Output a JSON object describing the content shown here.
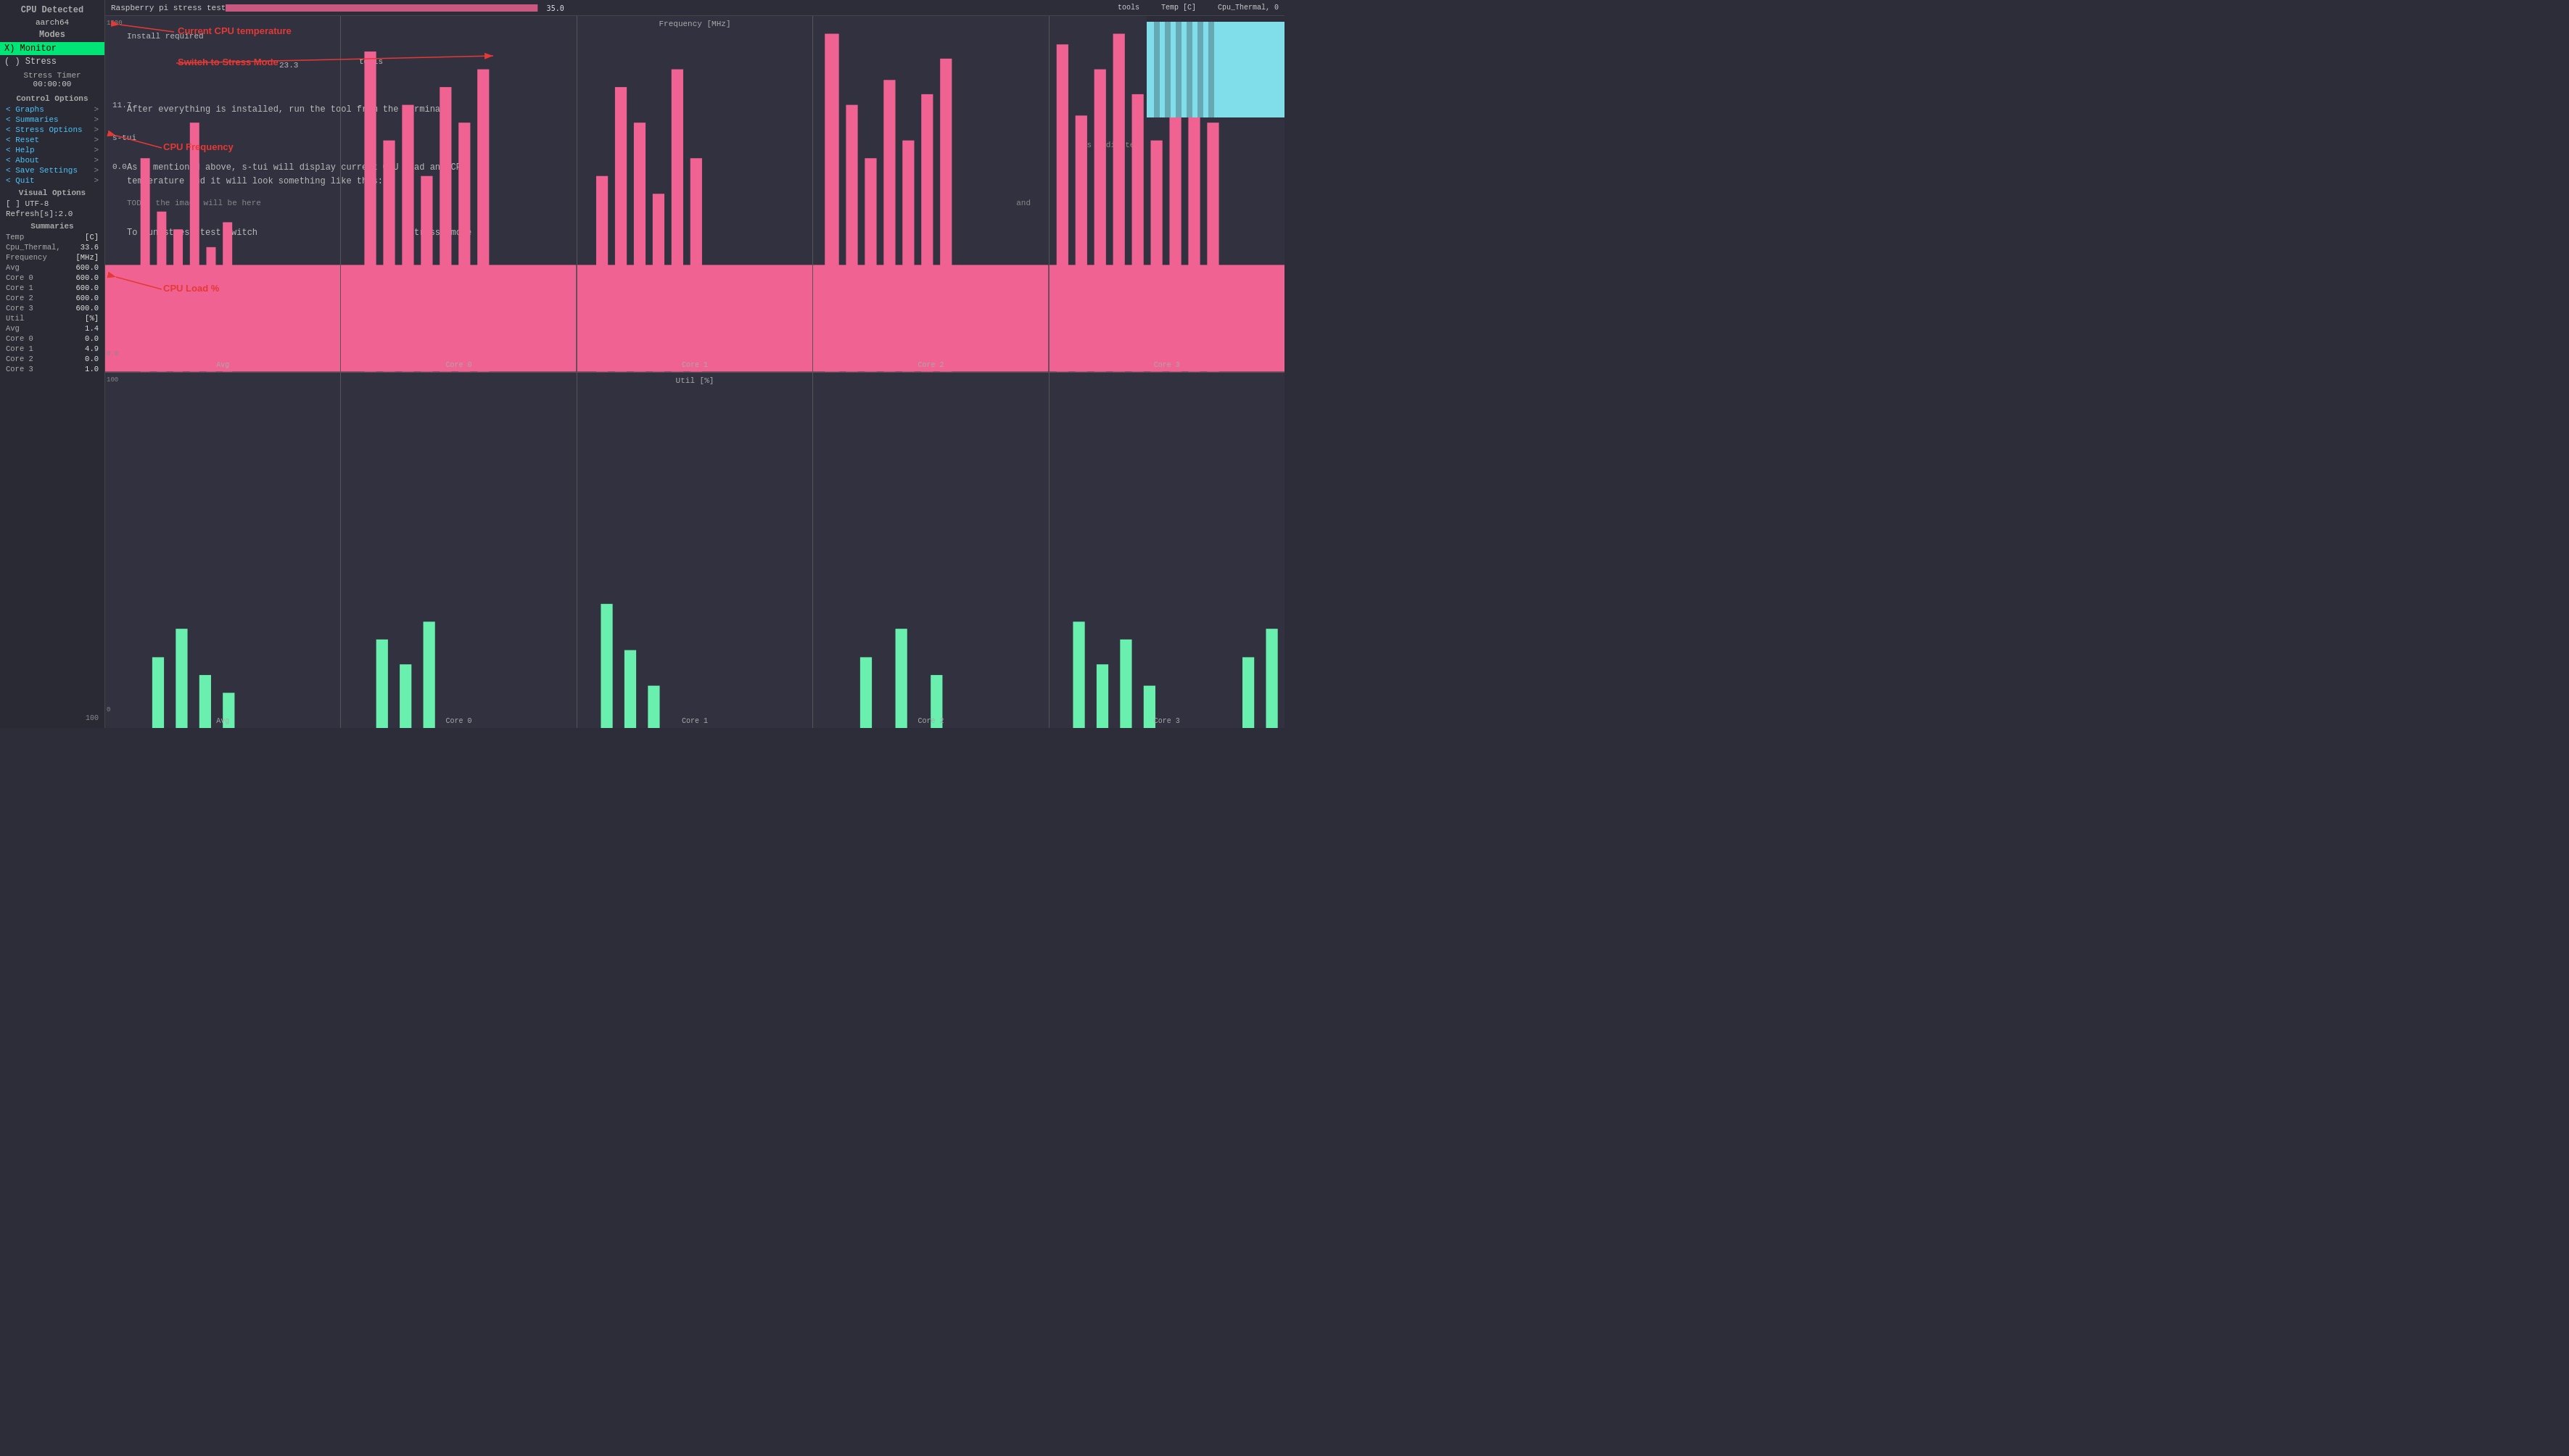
{
  "sidebar": {
    "cpu_detected_label": "CPU Detected",
    "cpu_arch": "aarch64",
    "modes_label": "Modes",
    "mode_monitor": "X) Monitor",
    "mode_stress": "( ) Stress",
    "stress_timer_label": "Stress Timer",
    "stress_timer_value": "00:00:00",
    "control_options_label": "Control Options",
    "menu_items": [
      {
        "label": "< Graphs",
        "chevron": ">"
      },
      {
        "label": "< Summaries",
        "chevron": ">"
      },
      {
        "label": "< Stress Options",
        "chevron": ">"
      },
      {
        "label": "< Reset",
        "chevron": ">"
      },
      {
        "label": "< Help",
        "chevron": ">"
      },
      {
        "label": "< About",
        "chevron": ">"
      },
      {
        "label": "< Save Settings",
        "chevron": ">"
      },
      {
        "label": "< Quit",
        "chevron": ">"
      }
    ],
    "visual_options_label": "Visual Options",
    "charset": "[ ] UTF-8",
    "refresh": "Refresh[s]:2.0",
    "summaries_label": "Summaries",
    "temp_label": "Temp",
    "temp_unit": "[C]",
    "temp_sensor": "Cpu_Thermal,",
    "temp_value": "33.6",
    "freq_label": "Frequency",
    "freq_unit": "[MHz]",
    "freq_avg_label": "Avg",
    "freq_avg_value": "600.0",
    "freq_core0_label": "Core 0",
    "freq_core0_value": "600.0",
    "freq_core1_label": "Core 1",
    "freq_core1_value": "600.0",
    "freq_core2_label": "Core 2",
    "freq_core2_value": "600.0",
    "freq_core3_label": "Core 3",
    "freq_core3_value": "600.0",
    "util_label": "Util",
    "util_unit": "[%]",
    "util_avg_label": "Avg",
    "util_avg_value": "1.4",
    "util_core0_label": "Core 0",
    "util_core0_value": "0.0",
    "util_core1_label": "Core 1",
    "util_core1_value": "4.9",
    "util_core2_label": "Core 2",
    "util_core2_value": "0.0",
    "util_core3_label": "Core 3",
    "util_core3_value": "1.0"
  },
  "topbar": {
    "title": "Raspberry pi stress test",
    "temp_current": "35.0",
    "tools_label": "tools",
    "temp_c_label": "Temp [C]",
    "cpu_thermal_label": "Cpu_Thermal, 0"
  },
  "freq_chart": {
    "y_max": "1500",
    "y_min": "0",
    "label_freq": "Frequency [MHz]",
    "sections": [
      "Avg",
      "Core 0",
      "Core 1",
      "Core 2",
      "Core 3"
    ]
  },
  "util_chart": {
    "y_max": "100",
    "y_min": "0",
    "label_util": "Util [%]",
    "sections": [
      "Avg",
      "Core 0",
      "Core 1",
      "Core 2",
      "Core 3"
    ]
  },
  "annotations": {
    "cpu_temp_label": "Current CPU temperature",
    "stress_mode_label": "Switch to Stress Mode",
    "cpu_freq_label": "CPU Frequency",
    "cpu_load_label": "CPU Load %"
  },
  "blog": {
    "line1": "Install required",
    "line2": "tools",
    "line3": "23.3",
    "line4": "After everything is installed, run the tool from the terminal:",
    "line5": "11.7",
    "line6": "s-tui",
    "line7": "0.0",
    "line8": "As I mentioned above, s-tui will display current CPU load and CPU",
    "line9": "temperature and it will look something like this:",
    "line10": "TODO: the image will be here",
    "line11": "To run stress test switch",
    "line12": "'stress' mode",
    "line13": "is indicated",
    "line14": "and"
  },
  "colors": {
    "pink": "#f06292",
    "green": "#69f0ae",
    "cyan_box": "#80deea",
    "sidebar_bg": "#2a2a35",
    "main_bg": "#2d2d3a",
    "annotation_red": "#e53935",
    "monitor_active_bg": "#00e676",
    "text_light": "#e0e0e0",
    "text_muted": "#888888"
  }
}
